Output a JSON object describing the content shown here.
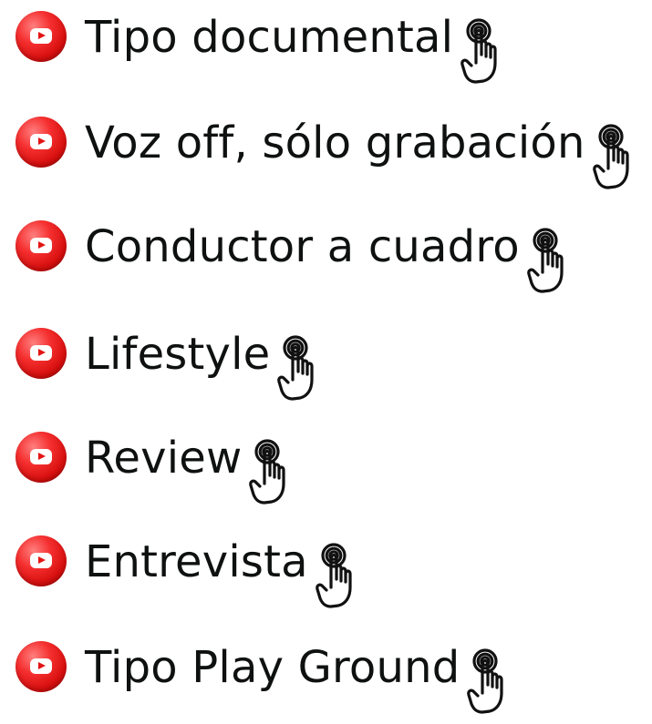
{
  "menu": {
    "items": [
      {
        "label": "Tipo documental",
        "icon": "youtube-play-icon",
        "cursor_icon": "pointing-hand-click-icon"
      },
      {
        "label": "Voz off, sólo grabación",
        "icon": "youtube-play-icon",
        "cursor_icon": "pointing-hand-click-icon"
      },
      {
        "label": "Conductor a cuadro",
        "icon": "youtube-play-icon",
        "cursor_icon": "pointing-hand-click-icon"
      },
      {
        "label": "Lifestyle",
        "icon": "youtube-play-icon",
        "cursor_icon": "pointing-hand-click-icon"
      },
      {
        "label": "Review",
        "icon": "youtube-play-icon",
        "cursor_icon": "pointing-hand-click-icon"
      },
      {
        "label": "Entrevista",
        "icon": "youtube-play-icon",
        "cursor_icon": "pointing-hand-click-icon"
      },
      {
        "label": "Tipo Play Ground",
        "icon": "youtube-play-icon",
        "cursor_icon": "pointing-hand-click-icon"
      }
    ]
  },
  "colors": {
    "text": "#0f1111",
    "youtube_red": "#e31414",
    "white": "#ffffff"
  }
}
